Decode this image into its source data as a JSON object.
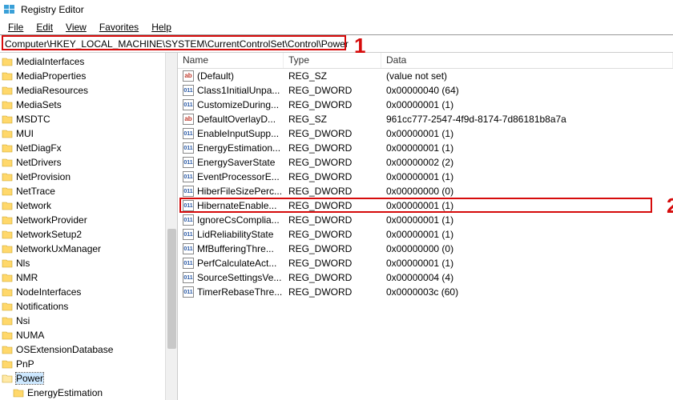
{
  "window": {
    "title": "Registry Editor"
  },
  "menu": {
    "file": "File",
    "edit": "Edit",
    "view": "View",
    "favorites": "Favorites",
    "help": "Help"
  },
  "address": {
    "path": "Computer\\HKEY_LOCAL_MACHINE\\SYSTEM\\CurrentControlSet\\Control\\Power"
  },
  "annotations": {
    "one": "1",
    "two": "2"
  },
  "tree": [
    "MediaInterfaces",
    "MediaProperties",
    "MediaResources",
    "MediaSets",
    "MSDTC",
    "MUI",
    "NetDiagFx",
    "NetDrivers",
    "NetProvision",
    "NetTrace",
    "Network",
    "NetworkProvider",
    "NetworkSetup2",
    "NetworkUxManager",
    "Nls",
    "NMR",
    "NodeInterfaces",
    "Notifications",
    "Nsi",
    "NUMA",
    "OSExtensionDatabase",
    "PnP",
    "Power",
    "EnergyEstimation"
  ],
  "tree_selected": "Power",
  "tree_child_of_power": "EnergyEstimation",
  "columns": {
    "name": "Name",
    "type": "Type",
    "data": "Data"
  },
  "values": [
    {
      "icon": "sz",
      "name": "(Default)",
      "type": "REG_SZ",
      "data": "(value not set)"
    },
    {
      "icon": "bin",
      "name": "Class1InitialUnpa...",
      "type": "REG_DWORD",
      "data": "0x00000040 (64)"
    },
    {
      "icon": "bin",
      "name": "CustomizeDuring...",
      "type": "REG_DWORD",
      "data": "0x00000001 (1)"
    },
    {
      "icon": "sz",
      "name": "DefaultOverlayD...",
      "type": "REG_SZ",
      "data": "961cc777-2547-4f9d-8174-7d86181b8a7a"
    },
    {
      "icon": "bin",
      "name": "EnableInputSupp...",
      "type": "REG_DWORD",
      "data": "0x00000001 (1)"
    },
    {
      "icon": "bin",
      "name": "EnergyEstimation...",
      "type": "REG_DWORD",
      "data": "0x00000001 (1)"
    },
    {
      "icon": "bin",
      "name": "EnergySaverState",
      "type": "REG_DWORD",
      "data": "0x00000002 (2)"
    },
    {
      "icon": "bin",
      "name": "EventProcessorE...",
      "type": "REG_DWORD",
      "data": "0x00000001 (1)"
    },
    {
      "icon": "bin",
      "name": "HiberFileSizePerc...",
      "type": "REG_DWORD",
      "data": "0x00000000 (0)"
    },
    {
      "icon": "bin",
      "name": "HibernateEnable...",
      "type": "REG_DWORD",
      "data": "0x00000001 (1)"
    },
    {
      "icon": "bin",
      "name": "IgnoreCsComplia...",
      "type": "REG_DWORD",
      "data": "0x00000001 (1)"
    },
    {
      "icon": "bin",
      "name": "LidReliabilityState",
      "type": "REG_DWORD",
      "data": "0x00000001 (1)"
    },
    {
      "icon": "bin",
      "name": "MfBufferingThre...",
      "type": "REG_DWORD",
      "data": "0x00000000 (0)"
    },
    {
      "icon": "bin",
      "name": "PerfCalculateAct...",
      "type": "REG_DWORD",
      "data": "0x00000001 (1)"
    },
    {
      "icon": "bin",
      "name": "SourceSettingsVe...",
      "type": "REG_DWORD",
      "data": "0x00000004 (4)"
    },
    {
      "icon": "bin",
      "name": "TimerRebaseThre...",
      "type": "REG_DWORD",
      "data": "0x0000003c (60)"
    }
  ],
  "highlighted_value_row_index": 9
}
